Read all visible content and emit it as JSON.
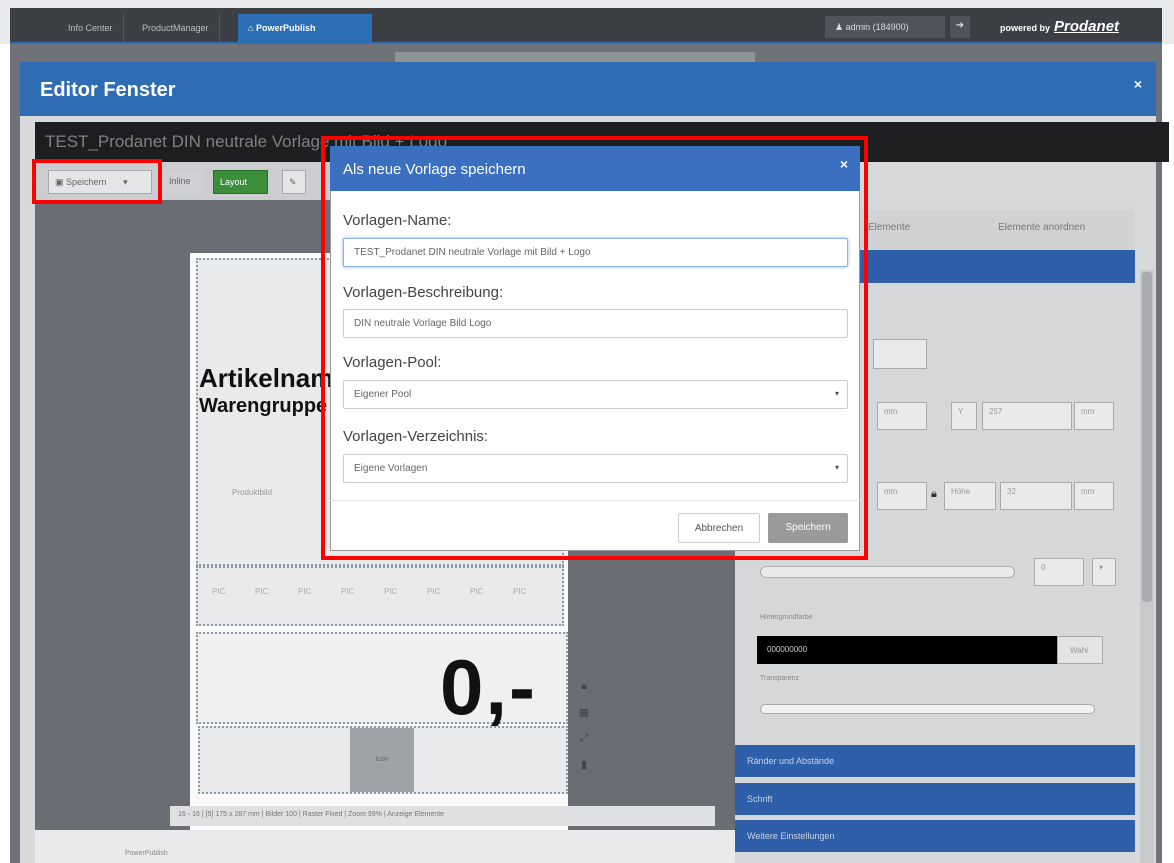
{
  "tabs": [
    {
      "label": "Info Center"
    },
    {
      "label": "ProductManager"
    },
    {
      "label": "PowerPublish"
    }
  ],
  "user": {
    "label": "admin (184900)"
  },
  "powered": {
    "prefix": "powered by",
    "brand": "Prodanet"
  },
  "editor": {
    "title": "Editor Fenster",
    "close": "×",
    "doc_title": "TEST_Prodanet DIN neutrale Vorlage mit Bild + Logo"
  },
  "toolbar": {
    "save_label": "Speichern",
    "save_caret": "▾",
    "inline_label": "Inline",
    "layout_label": "Layout"
  },
  "canvas": {
    "artikel": "Artikelname",
    "warengruppe": "Warengruppe",
    "produktbild": "Produktbild",
    "price": "0,-",
    "pill": "PIC",
    "grey": "Icon"
  },
  "bottom_tools": "16 ◦ 16  |  [5] 175 x 287 mm  |  Bilder 100  |  Raster Fixed  |  Zoom 99%  |  Anzeige Elemente",
  "statusbar": {
    "text": "PowerPublish"
  },
  "right_panel": {
    "tab1": "Elemente",
    "tab2": "Elemente anordnen",
    "y_label": "Y",
    "y_value": "257",
    "unit": "mm",
    "hoehe_label": "Höhe",
    "hoehe_value": "32",
    "x_unit": "mm",
    "breite_unit": "mm",
    "pad_value": "0",
    "fill_label": "Hintergrundfarbe",
    "fill_value": "000000000",
    "fill_btn": "Wahl",
    "trans_label": "Transparenz",
    "section1": "Ränder und Abstände",
    "section2": "Schrift",
    "section3": "Weitere Einstellungen"
  },
  "modal": {
    "title": "Als neue Vorlage speichern",
    "close": "×",
    "name_label": "Vorlagen-Name:",
    "name_value": "TEST_Prodanet DIN neutrale Vorlage mit Bild + Logo",
    "desc_label": "Vorlagen-Beschreibung:",
    "desc_value": "DIN neutrale Vorlage  Bild  Logo",
    "pool_label": "Vorlagen-Pool:",
    "pool_value": "Eigener Pool",
    "dir_label": "Vorlagen-Verzeichnis:",
    "dir_value": "Eigene Vorlagen",
    "cancel": "Abbrechen",
    "save": "Speichern"
  }
}
